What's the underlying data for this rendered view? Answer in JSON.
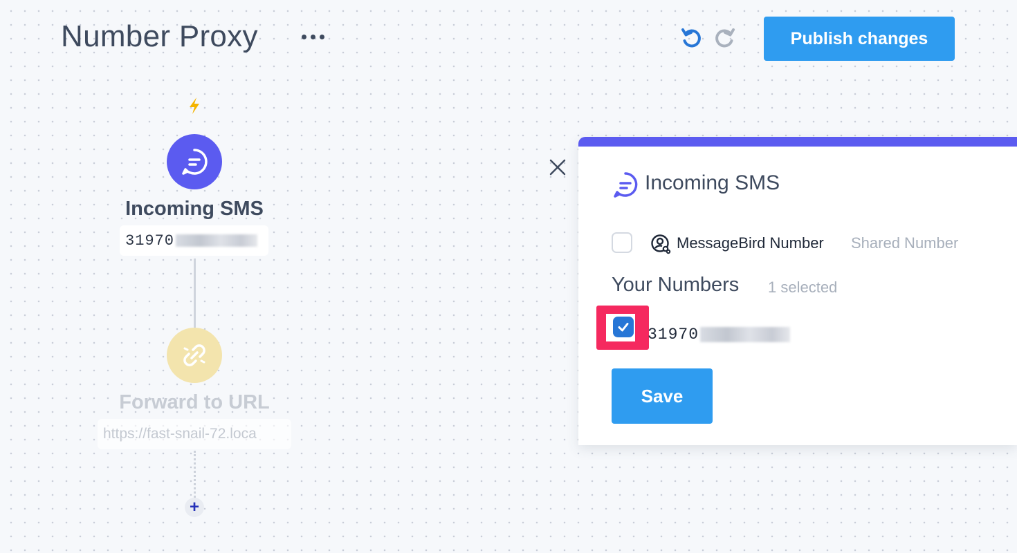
{
  "header": {
    "title": "Number Proxy",
    "publish_label": "Publish changes"
  },
  "flow": {
    "trigger": {
      "title": "Incoming SMS",
      "number_prefix": "31970"
    },
    "step": {
      "title": "Forward to URL",
      "url": "https://fast-snail-72.loca"
    },
    "add_label": "+"
  },
  "panel": {
    "title": "Incoming SMS",
    "messagebird_option": {
      "label": "MessageBird Number",
      "tag": "Shared Number",
      "checked": false
    },
    "your_numbers": {
      "heading": "Your Numbers",
      "selected_count": "1 selected",
      "items": [
        {
          "number_prefix": "31970",
          "checked": true
        }
      ]
    },
    "save_label": "Save"
  },
  "colors": {
    "primary": "#2f9cf0",
    "accent": "#5b5bf0",
    "highlight": "#f5295f",
    "bolt": "#f4b400"
  },
  "icons": {
    "more": "more-icon",
    "undo": "undo-icon",
    "redo": "redo-icon",
    "trigger": "chat-icon",
    "step": "link-icon",
    "close": "close-icon",
    "messagebird": "user-link-icon",
    "check": "check-icon"
  }
}
